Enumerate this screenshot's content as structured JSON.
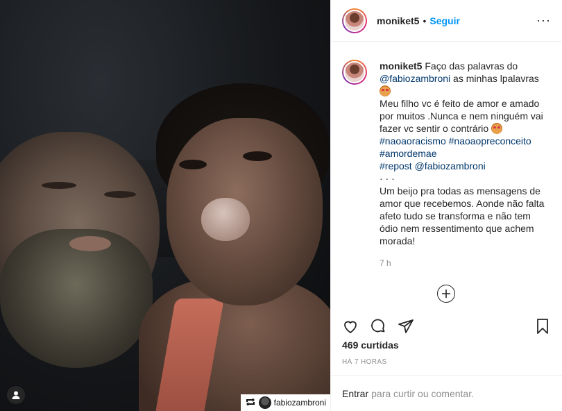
{
  "post": {
    "username": "moniket5",
    "follow_label": "Seguir",
    "separator": "•",
    "more_glyph": "···"
  },
  "caption": {
    "username": "moniket5",
    "line1_text": " Faço das palavras do",
    "mention1": "@fabiozambroni",
    "line2_rest": " as minhas lpalavras",
    "para2": "Meu filho vc é feito de amor e amado por muitos .Nunca e nem ninguém vai fazer vc sentir o contrário",
    "hashtag1": "#naoaoracismo",
    "hashtag2": "#naoaopreconceito",
    "hashtag3": "#amordemae",
    "repost_hashtag": "#repost",
    "repost_mention": "@fabiozambroni",
    "dots": "· · ·",
    "para3": "Um beijo pra todas as mensagens de amor que recebemos. Aonde não falta afeto tudo se transforma e não tem ódio nem ressentimento que achem morada!",
    "time": "7 h"
  },
  "stats": {
    "likes": "469 curtidas",
    "posted": "HÁ 7 HORAS"
  },
  "comment": {
    "enter_label": "Entrar",
    "rest_label": "para curtir ou comentar."
  },
  "repost_badge": {
    "username": "fabiozambroni"
  },
  "icons": {
    "more": "more-icon",
    "heart": "heart-icon",
    "comment": "comment-icon",
    "share": "share-icon",
    "save": "bookmark-icon",
    "add": "plus-circle-icon",
    "user_tag": "user-tag-icon",
    "repost": "repost-icon"
  },
  "colors": {
    "accent": "#0095f6",
    "link": "#00376b",
    "muted": "#8e8e8e"
  }
}
